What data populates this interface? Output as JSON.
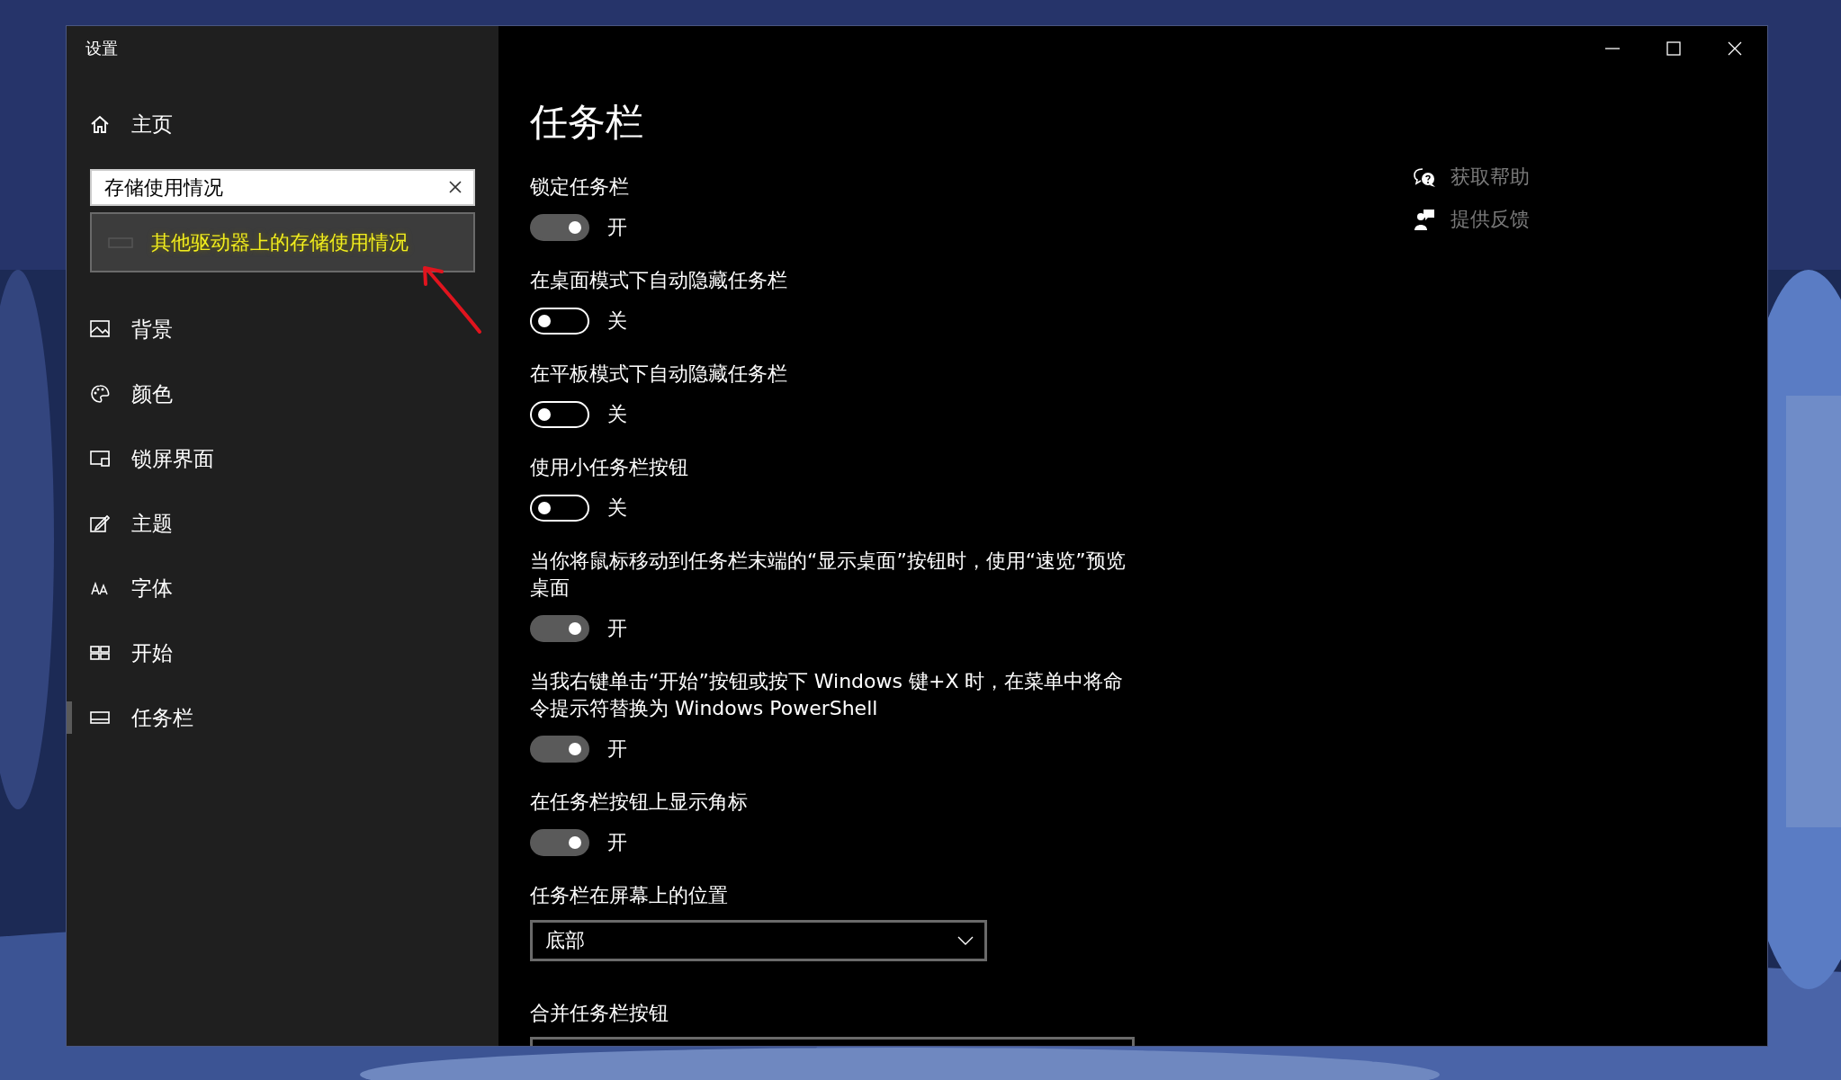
{
  "window": {
    "title": "设置"
  },
  "sidebar": {
    "home": "主页",
    "search": {
      "value": "存储使用情况"
    },
    "suggestions": [
      {
        "text": "其他驱动器上的存储使用情况"
      }
    ],
    "items": [
      {
        "kind": "background",
        "label": "背景",
        "selected": false
      },
      {
        "kind": "colors",
        "label": "颜色",
        "selected": false
      },
      {
        "kind": "lockscreen",
        "label": "锁屏界面",
        "selected": false
      },
      {
        "kind": "themes",
        "label": "主题",
        "selected": false
      },
      {
        "kind": "fonts",
        "label": "字体",
        "selected": false
      },
      {
        "kind": "start",
        "label": "开始",
        "selected": false
      },
      {
        "kind": "taskbar",
        "label": "任务栏",
        "selected": true
      }
    ]
  },
  "content": {
    "title": "任务栏",
    "settings": [
      {
        "kind": "toggle",
        "label": "锁定任务栏",
        "on": true,
        "state_text": "开"
      },
      {
        "kind": "toggle",
        "label": "在桌面模式下自动隐藏任务栏",
        "on": false,
        "state_text": "关"
      },
      {
        "kind": "toggle",
        "label": "在平板模式下自动隐藏任务栏",
        "on": false,
        "state_text": "关"
      },
      {
        "kind": "toggle",
        "label": "使用小任务栏按钮",
        "on": false,
        "state_text": "关"
      },
      {
        "kind": "toggle",
        "label": "当你将鼠标移动到任务栏末端的“显示桌面”按钮时，使用“速览”预览桌面",
        "on": true,
        "state_text": "开"
      },
      {
        "kind": "toggle",
        "label": "当我右键单击“开始”按钮或按下 Windows 键+X 时，在菜单中将命令提示符替换为 Windows PowerShell",
        "on": true,
        "state_text": "开"
      },
      {
        "kind": "toggle",
        "label": "在任务栏按钮上显示角标",
        "on": true,
        "state_text": "开"
      },
      {
        "kind": "dropdown",
        "label": "任务栏在屏幕上的位置",
        "value": "底部"
      },
      {
        "kind": "dropdown",
        "label": "合并任务栏按钮"
      }
    ],
    "help_links": [
      {
        "kind": "help",
        "text": "获取帮助"
      },
      {
        "kind": "feedback",
        "text": "提供反馈"
      }
    ]
  },
  "annotations": [
    {
      "kind": "arrow"
    }
  ]
}
